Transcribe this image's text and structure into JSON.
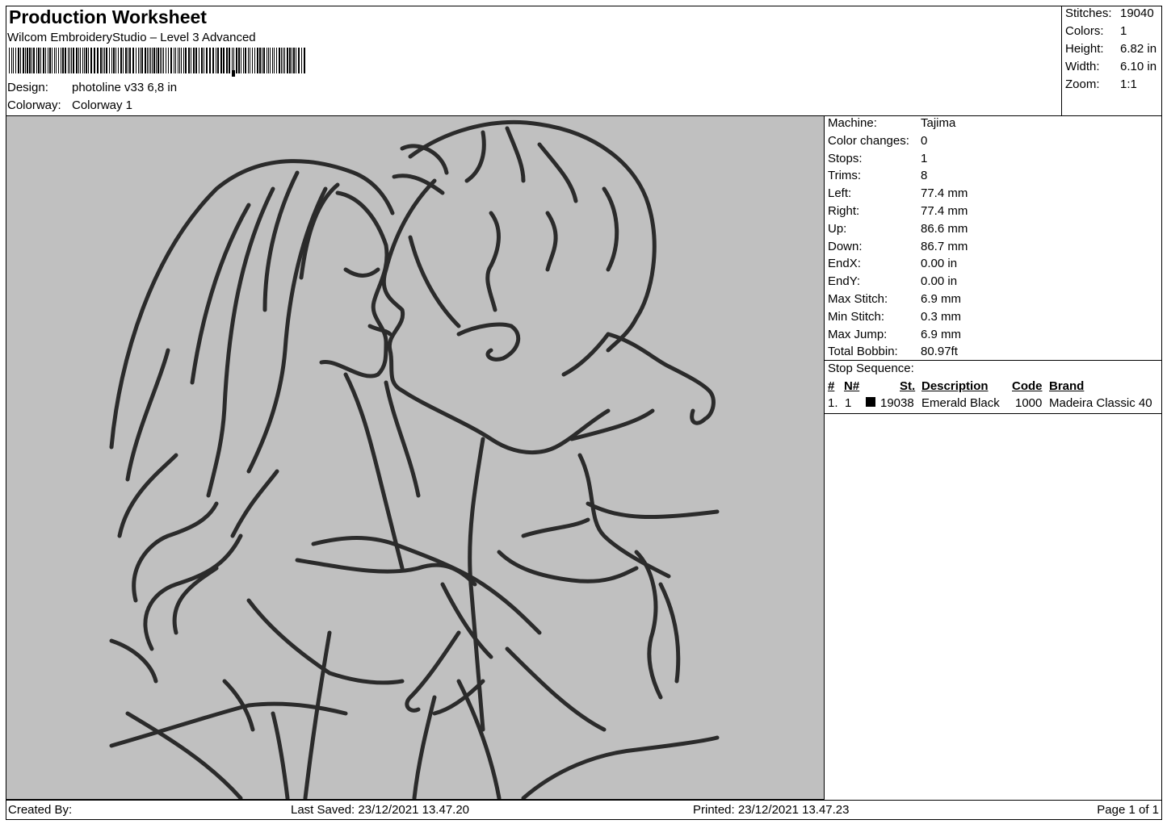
{
  "header": {
    "title": "Production Worksheet",
    "subtitle": "Wilcom EmbroideryStudio – Level 3 Advanced",
    "design_label": "Design:",
    "design_value": "photoline v33 6,8 in",
    "colorway_label": "Colorway:",
    "colorway_value": "Colorway 1"
  },
  "summary": [
    {
      "label": "Stitches:",
      "value": "19040"
    },
    {
      "label": "Colors:",
      "value": "1"
    },
    {
      "label": "Height:",
      "value": "6.82 in"
    },
    {
      "label": "Width:",
      "value": "6.10 in"
    },
    {
      "label": "Zoom:",
      "value": "1:1"
    }
  ],
  "details": [
    {
      "label": "Machine:",
      "value": "Tajima"
    },
    {
      "label": "Color changes:",
      "value": "0"
    },
    {
      "label": "Stops:",
      "value": "1"
    },
    {
      "label": "Trims:",
      "value": "8"
    },
    {
      "label": "Left:",
      "value": "77.4 mm"
    },
    {
      "label": "Right:",
      "value": "77.4 mm"
    },
    {
      "label": "Up:",
      "value": "86.6 mm"
    },
    {
      "label": "Down:",
      "value": "86.7 mm"
    },
    {
      "label": "EndX:",
      "value": "0.00 in"
    },
    {
      "label": "EndY:",
      "value": "0.00 in"
    },
    {
      "label": "Max Stitch:",
      "value": "6.9 mm"
    },
    {
      "label": "Min Stitch:",
      "value": "0.3 mm"
    },
    {
      "label": "Max Jump:",
      "value": "6.9 mm"
    },
    {
      "label": "Total Bobbin:",
      "value": "80.97ft"
    }
  ],
  "stop_sequence": {
    "title": "Stop Sequence:",
    "headers": [
      "#",
      "N#",
      "St.",
      "Description",
      "Code",
      "Brand"
    ],
    "rows": [
      {
        "index": "1.",
        "needle": "1",
        "swatch_color": "#000000",
        "stitches": "19038",
        "description": "Emerald Black",
        "code": "1000",
        "brand": "Madeira Classic 40"
      }
    ]
  },
  "footer": {
    "created_by": "Created By:",
    "last_saved": "Last Saved: 23/12/2021 13.47.20",
    "printed": "Printed: 23/12/2021 13.47.23",
    "page": "Page 1 of 1"
  },
  "colors": {
    "preview_background": "#c0c0c0",
    "thread": "#2b2b2b"
  }
}
